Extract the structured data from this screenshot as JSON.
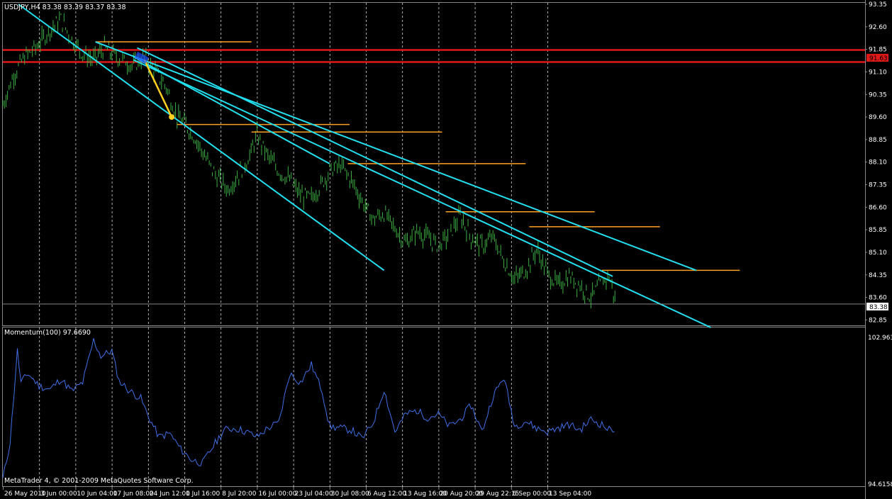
{
  "chart_data": [
    {
      "type": "candlestick",
      "title": "USDJPY,H4  83.38 83.39 83.37 83.38",
      "symbol": "USDJPY",
      "timeframe": "H4",
      "ohlc_readout": [
        83.38,
        83.39,
        83.37,
        83.38
      ],
      "last_price": "83.38",
      "marked_level": "91.63",
      "ylim": [
        82.6,
        93.35
      ],
      "y_ticks": [
        "93.35",
        "92.60",
        "91.85",
        "91.10",
        "90.35",
        "89.60",
        "88.85",
        "88.10",
        "87.35",
        "86.60",
        "85.85",
        "85.10",
        "84.35",
        "83.60",
        "82.85"
      ],
      "x_ticks": [
        "26 May 2010",
        "3 Jun 00:00",
        "10 Jun 04:00",
        "17 Jun 08:00",
        "24 Jun 12:00",
        "1 Jul 16:00",
        "8 Jul 20:00",
        "16 Jul 00:00",
        "23 Jul 04:00",
        "30 Jul 08:00",
        "6 Aug 12:00",
        "13 Aug 16:00",
        "20 Aug 20:00",
        "29 Aug 22:15",
        "6 Sep 00:00",
        "13 Sep 04:00"
      ],
      "price_path": [
        [
          0,
          90.0
        ],
        [
          0.3,
          91.0
        ],
        [
          0.6,
          91.6
        ],
        [
          0.9,
          91.9
        ],
        [
          1.3,
          92.5
        ],
        [
          1.6,
          92.85
        ],
        [
          1.9,
          92.2
        ],
        [
          2.2,
          91.7
        ],
        [
          2.5,
          91.5
        ],
        [
          2.8,
          91.9
        ],
        [
          3.0,
          91.7
        ],
        [
          3.3,
          91.5
        ],
        [
          3.6,
          91.3
        ],
        [
          3.9,
          91.6
        ],
        [
          4.2,
          91.1
        ],
        [
          4.5,
          90.6
        ],
        [
          4.8,
          89.6
        ],
        [
          5.0,
          89.4
        ],
        [
          5.3,
          88.9
        ],
        [
          5.6,
          88.2
        ],
        [
          5.9,
          87.6
        ],
        [
          6.2,
          87.2
        ],
        [
          6.5,
          87.7
        ],
        [
          6.8,
          88.3
        ],
        [
          7.0,
          89.0
        ],
        [
          7.3,
          88.3
        ],
        [
          7.6,
          87.8
        ],
        [
          7.9,
          87.5
        ],
        [
          8.2,
          87.0
        ],
        [
          8.5,
          86.9
        ],
        [
          8.8,
          87.4
        ],
        [
          9.0,
          87.8
        ],
        [
          9.3,
          88.0
        ],
        [
          9.6,
          87.5
        ],
        [
          9.9,
          86.8
        ],
        [
          10.2,
          86.2
        ],
        [
          10.5,
          86.4
        ],
        [
          10.8,
          85.9
        ],
        [
          11.1,
          85.4
        ],
        [
          11.4,
          85.8
        ],
        [
          11.7,
          85.6
        ],
        [
          12.0,
          85.3
        ],
        [
          12.3,
          85.7
        ],
        [
          12.6,
          86.3
        ],
        [
          12.9,
          85.6
        ],
        [
          13.2,
          85.3
        ],
        [
          13.5,
          85.6
        ],
        [
          13.8,
          84.8
        ],
        [
          14.1,
          84.2
        ],
        [
          14.4,
          84.5
        ],
        [
          14.7,
          85.2
        ],
        [
          15.0,
          84.4
        ],
        [
          15.3,
          84.0
        ],
        [
          15.6,
          84.3
        ],
        [
          15.9,
          84.0
        ],
        [
          16.2,
          83.6
        ],
        [
          16.5,
          84.1
        ],
        [
          16.7,
          84.3
        ],
        [
          16.9,
          83.38
        ]
      ],
      "trend_lines": [
        {
          "x1": 0.43,
          "y1": 93.35,
          "x2": 10.5,
          "y2": 84.5
        },
        {
          "x1": 2.55,
          "y1": 92.1,
          "x2": 19.1,
          "y2": 84.5
        },
        {
          "x1": 3.7,
          "y1": 91.9,
          "x2": 16.8,
          "y2": 84.3
        },
        {
          "x1": 3.6,
          "y1": 91.6,
          "x2": 9.0,
          "y2": 88.05
        },
        {
          "x1": 3.6,
          "y1": 91.5,
          "x2": 19.5,
          "y2": 82.6
        }
      ],
      "level_lines": [
        {
          "x1": 2.55,
          "x2": 6.85,
          "y": 92.1
        },
        {
          "x1": 4.8,
          "x2": 9.55,
          "y": 89.35
        },
        {
          "x1": 6.85,
          "x2": 12.1,
          "y": 89.1
        },
        {
          "x1": 9.5,
          "x2": 14.4,
          "y": 88.05
        },
        {
          "x1": 12.2,
          "x2": 16.3,
          "y": 86.45
        },
        {
          "x1": 14.5,
          "x2": 18.1,
          "y": 85.95
        },
        {
          "x1": 16.5,
          "x2": 20.3,
          "y": 84.5
        }
      ],
      "projection_arrow": {
        "x1": 3.9,
        "y1": 91.5,
        "x2": 4.65,
        "y2": 89.6
      },
      "colors": {
        "candles": "#3cb043",
        "trend": "#22e0f0",
        "levels": "#ffa020",
        "red_band": "#e01818",
        "arrow": "#ffd020",
        "grid": "#ffffff"
      }
    },
    {
      "type": "line",
      "title": "Momentum(100) 97.6690",
      "indicator": "Momentum(100)",
      "value": "97.6690",
      "ylim": [
        94.6158,
        102.963
      ],
      "y_ticks": [
        "102.963",
        "94.6158"
      ],
      "x": [
        0,
        0.2,
        0.4,
        0.5,
        0.7,
        1.0,
        1.3,
        1.6,
        1.9,
        2.2,
        2.5,
        2.7,
        3.0,
        3.2,
        3.5,
        3.8,
        4.0,
        4.3,
        4.6,
        4.9,
        5.2,
        5.5,
        5.8,
        6.1,
        6.4,
        6.7,
        7.0,
        7.3,
        7.6,
        7.9,
        8.2,
        8.5,
        8.8,
        9.0,
        9.3,
        9.6,
        9.9,
        10.2,
        10.5,
        10.8,
        11.1,
        11.4,
        11.7,
        12.0,
        12.3,
        12.6,
        12.9,
        13.2,
        13.5,
        13.8,
        14.1,
        14.4,
        14.7,
        15.0,
        15.3,
        15.6,
        15.9,
        16.2,
        16.5,
        16.7,
        16.9
      ],
      "y": [
        94.9,
        97.0,
        102.2,
        100.4,
        100.9,
        100.2,
        100.0,
        100.6,
        99.9,
        100.4,
        102.8,
        101.9,
        102.2,
        100.5,
        99.9,
        99.5,
        98.5,
        97.3,
        97.5,
        96.6,
        96.0,
        95.8,
        96.8,
        97.7,
        97.8,
        97.6,
        97.3,
        97.8,
        98.1,
        100.9,
        100.4,
        101.4,
        99.9,
        97.9,
        97.8,
        97.7,
        97.2,
        98.1,
        100.0,
        97.6,
        98.6,
        98.8,
        98.4,
        98.6,
        97.9,
        98.3,
        99.1,
        97.6,
        99.6,
        100.7,
        97.9,
        98.2,
        97.8,
        97.6,
        97.8,
        98.0,
        97.7,
        98.3,
        98.0,
        97.7,
        97.8
      ],
      "colors": {
        "line": "#3f6fe8"
      }
    }
  ],
  "footer": {
    "copyright": "MetaTrader 4, © 2001-2009 MetaQuotes Software Corp."
  }
}
